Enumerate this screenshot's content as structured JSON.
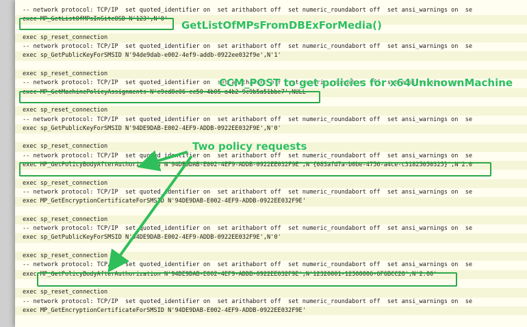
{
  "log_lines": [
    "-- network protocol: TCP/IP  set quoted_identifier on  set arithabort off  set numeric_roundabort off  set ansi_warnings on  se",
    "exec MP_GetListOfMPsInSiteOSD N'123',N'0'",
    "",
    "exec sp_reset_connection",
    "-- network protocol: TCP/IP  set quoted_identifier on  set arithabort off  set numeric_roundabort off  set ansi_warnings on  se",
    "exec sp_GetPublicKeyForSMSID N'94de9dab-e002-4ef9-addb-0922ee032f9e',N'1'",
    "",
    "exec sp_reset_connection",
    "-- network protocol: TCP/IP  set quoted_identifier on  set arithabort off  set numeric_roundabort off  set ansi_warnings on  se",
    "exec MP_GetMachinePolicyAssignments N'e9cd8c06-cc50-4b05-a4b2-9c9b5a51bbe7',NULL",
    "",
    "exec sp_reset_connection",
    "-- network protocol: TCP/IP  set quoted_identifier on  set arithabort off  set numeric_roundabort off  set ansi_warnings on  se",
    "exec sp_GetPublicKeyForSMSID N'94DE9DAB-E002-4EF9-ADDB-0922EE032F9E',N'0'",
    "",
    "exec sp_reset_connection",
    "-- network protocol: TCP/IP  set quoted_identifier on  set arithabort off  set numeric_roundabort off  set ansi_warnings on  se",
    "exec MP_GetPolicyBodyAfterAuthorization N'94DE9DAB-E002-4EF9-ADDB-0922EE032F9E',N'{083afd7a-b0be-4756-a4ce-c31825050325}',N'2.0",
    "",
    "exec sp_reset_connection",
    "-- network protocol: TCP/IP  set quoted_identifier on  set arithabort off  set numeric_roundabort off  set ansi_warnings on  se",
    "exec MP_GetEncryptionCertificateForSMSID N'94DE9DAB-E002-4EF9-ADDB-0922EE032F9E'",
    "",
    "exec sp_reset_connection",
    "-- network protocol: TCP/IP  set quoted_identifier on  set arithabort off  set numeric_roundabort off  set ansi_warnings on  se",
    "exec sp_GetPublicKeyForSMSID N'94DE9DAB-E002-4EF9-ADDB-0922EE032F9E',N'0'",
    "",
    "exec sp_reset_connection",
    "-- network protocol: TCP/IP  set quoted_identifier on  set arithabort off  set numeric_roundabort off  set ansi_warnings on  se",
    "exec MP_GetPolicyBodyAfterAuthorization N'94DE9DAB-E002-4EF9-ADDB-0922EE032F9E',N'12320001-12300006-6F6BCC28',N'2.00'",
    "",
    "exec sp_reset_connection",
    "-- network protocol: TCP/IP  set quoted_identifier on  set arithabort off  set numeric_roundabort off  set ansi_warnings on  se",
    "exec MP_GetEncryptionCertificateForSMSID N'94DE9DAB-E002-4EF9-ADDB-0922EE032F9E'"
  ],
  "annotations": {
    "getlist": "GetListOfMPsFromDBExForMedia()",
    "ccm_post": "CCM_POST to get policies for x64UnknownMachine",
    "two_policy": "Two policy requests"
  },
  "colors": {
    "annotation_green": "#2fbf5a",
    "box_green": "#2aa84a",
    "page_bg": "#fffef0",
    "alt_row_bg": "#f5f5d8"
  }
}
